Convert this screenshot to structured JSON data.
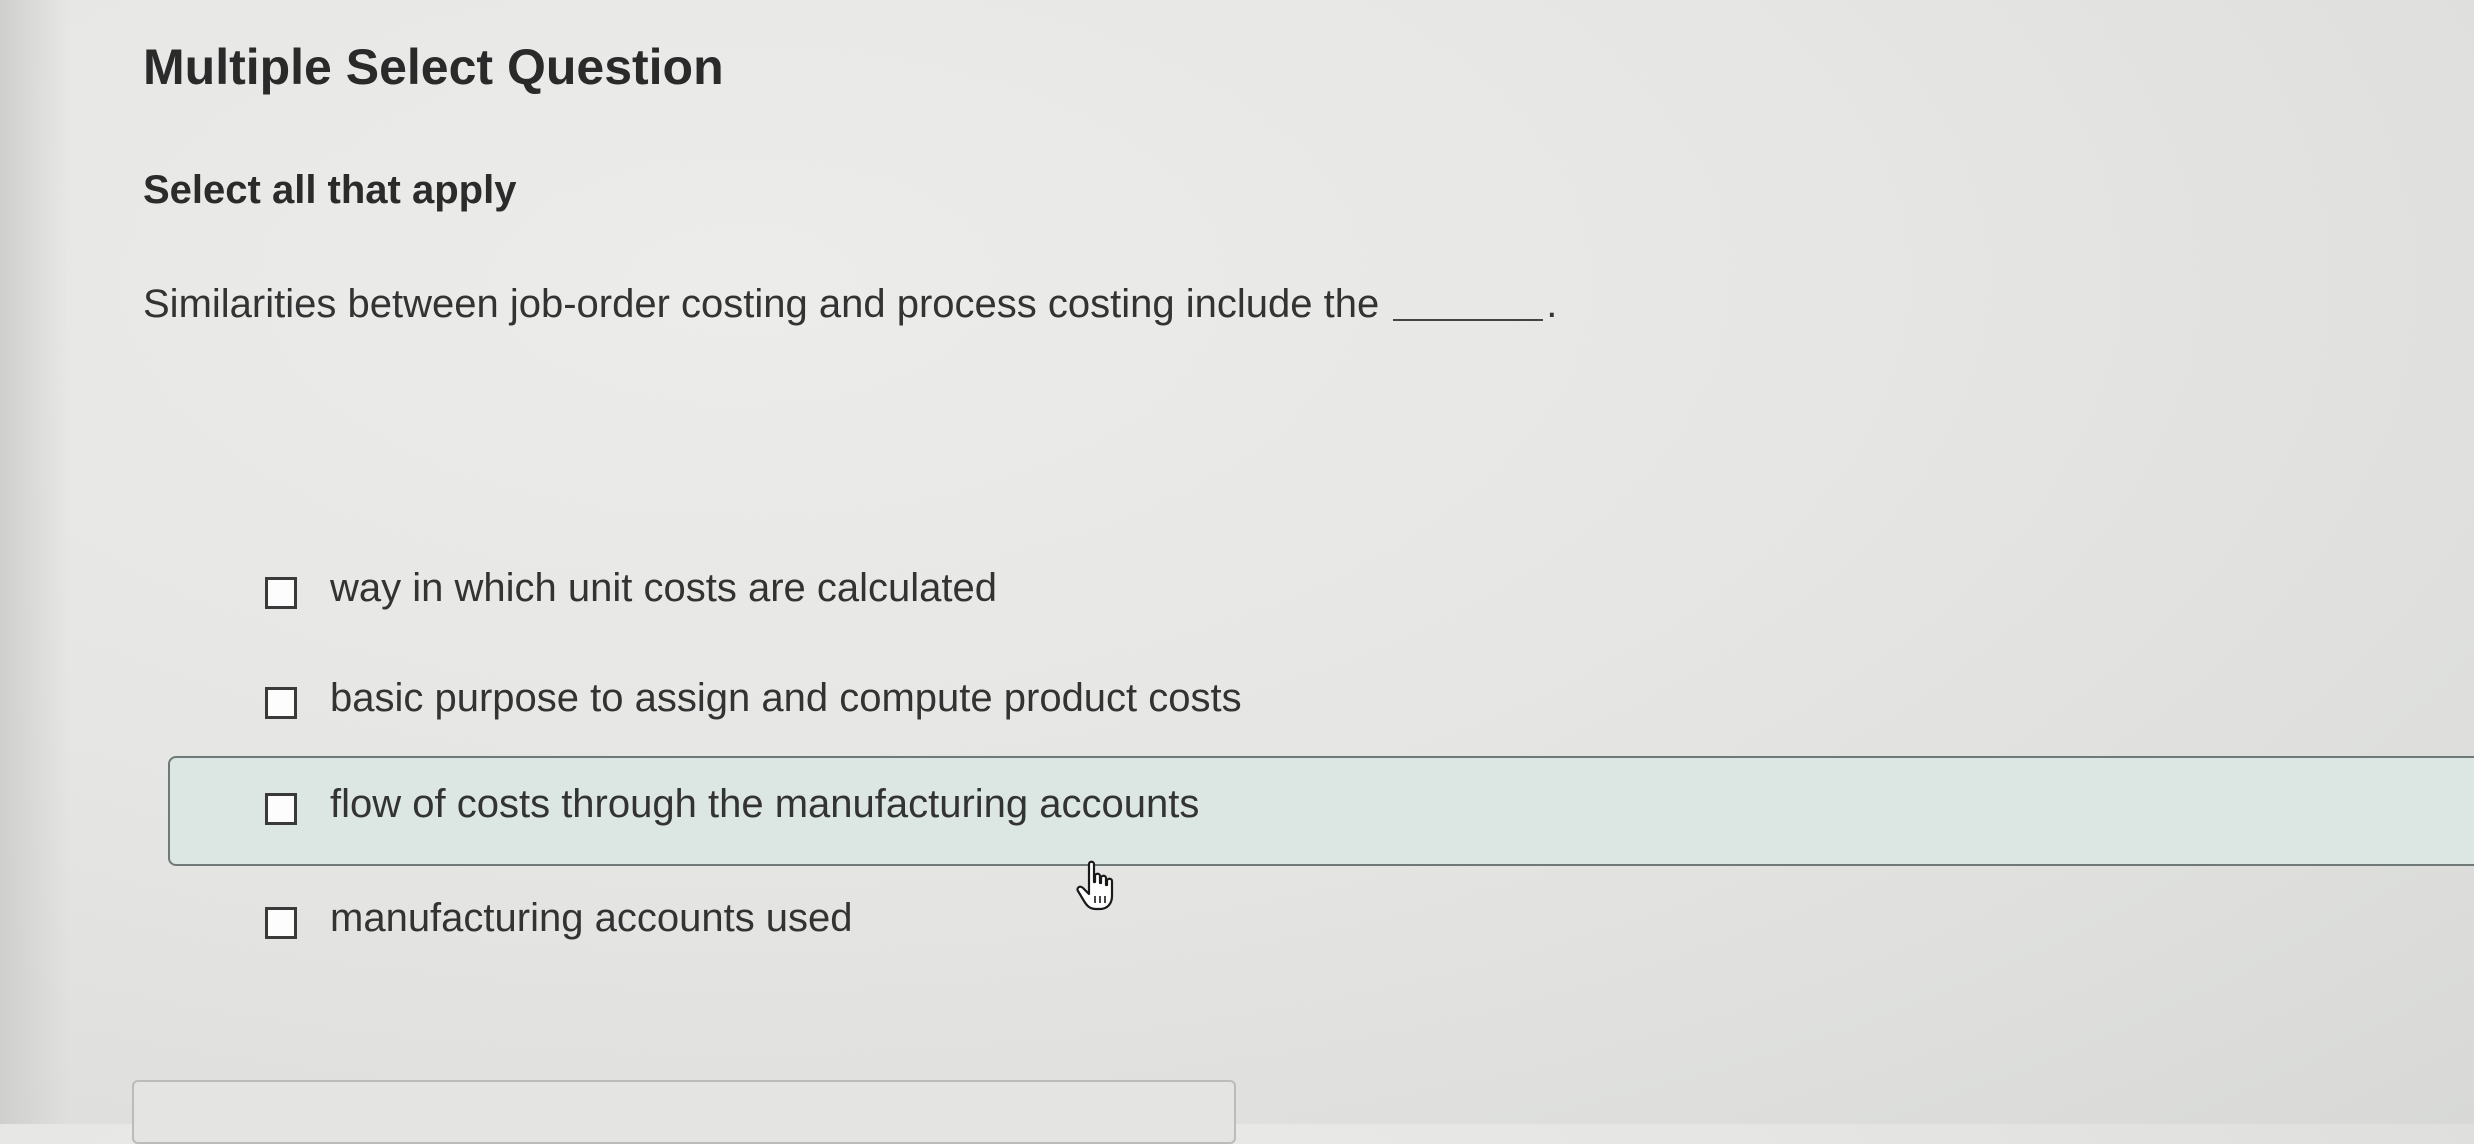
{
  "title": "Multiple Select Question",
  "instruction": "Select all that apply",
  "question": {
    "text": "Similarities between job-order costing and process costing include the",
    "end": "."
  },
  "options": [
    {
      "label": "way in which unit costs are calculated",
      "checked": false
    },
    {
      "label": "basic purpose to assign and compute product costs",
      "checked": false
    },
    {
      "label": "flow of costs through the manufacturing accounts",
      "checked": false,
      "hovered": true
    },
    {
      "label": "manufacturing accounts used",
      "checked": false
    }
  ],
  "colors": {
    "hover_background": "#dce7e4",
    "text": "#333333"
  },
  "icons": {
    "cursor": "hand-pointer-icon",
    "checkbox": "checkbox-unchecked-icon"
  }
}
